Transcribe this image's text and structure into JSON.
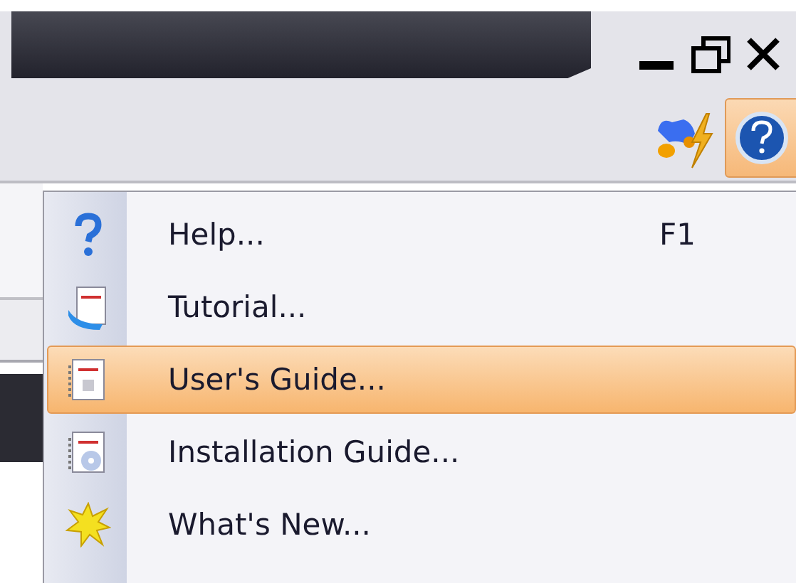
{
  "window_controls": [
    {
      "kind": "minimize"
    },
    {
      "kind": "restore"
    },
    {
      "kind": "close"
    }
  ],
  "toolbar": {
    "buttons": [
      {
        "kind": "plugin",
        "selected": false
      },
      {
        "kind": "help",
        "selected": true
      }
    ]
  },
  "help_menu": {
    "items": [
      {
        "label": "Help...",
        "shortcut": "F1",
        "kind": "help",
        "selected": false
      },
      {
        "label": "Tutorial...",
        "kind": "tutorial",
        "selected": false
      },
      {
        "label": "User's Guide...",
        "kind": "guide",
        "selected": true
      },
      {
        "label": "Installation Guide...",
        "kind": "install",
        "selected": false
      },
      {
        "label": "What's New...",
        "kind": "new",
        "selected": false
      }
    ]
  }
}
